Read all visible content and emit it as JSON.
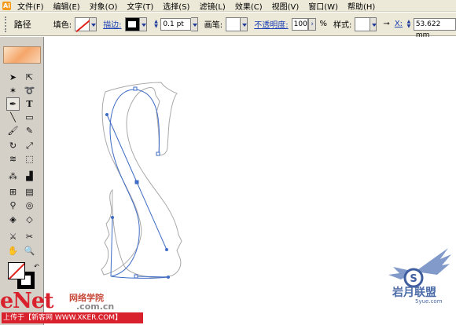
{
  "app": {
    "icon_letter": "Ai"
  },
  "menu": {
    "items": [
      "文件(F)",
      "编辑(E)",
      "对象(O)",
      "文字(T)",
      "选择(S)",
      "滤镜(L)",
      "效果(C)",
      "视图(V)",
      "窗口(W)",
      "帮助(H)"
    ]
  },
  "control_bar": {
    "object_type": "路径",
    "fill_label": "填色:",
    "stroke_label": "描边:",
    "stroke_weight": "0.1 pt",
    "brush_label": "画笔:",
    "opacity_label": "不透明度:",
    "opacity_value": "100",
    "opacity_unit": "%",
    "style_label": "样式:",
    "x_label": "X:",
    "x_value": "53.622 mm"
  },
  "toolbox": {
    "tools": [
      "selection-tool",
      "direct-selection-tool",
      "magic-wand-tool",
      "lasso-tool",
      "pen-tool",
      "type-tool",
      "line-tool",
      "rectangle-tool",
      "paintbrush-tool",
      "pencil-tool",
      "rotate-tool",
      "scale-tool",
      "warp-tool",
      "free-transform-tool",
      "symbol-sprayer-tool",
      "column-graph-tool",
      "mesh-tool",
      "gradient-tool",
      "eyedropper-tool",
      "blend-tool",
      "live-paint-tool",
      "live-paint-selection-tool",
      "slice-tool",
      "scissors-tool",
      "hand-tool",
      "zoom-tool"
    ],
    "fill": "none",
    "stroke": "#000000"
  },
  "watermarks": {
    "enet": "eNet",
    "enet_cn": "网络学院",
    "enet_com": ".com.cn",
    "upload": "上传于【新客网 WWW.XKER.COM】",
    "logo_text": "岩月联盟",
    "logo_sub": "5yue.com"
  },
  "colors": {
    "path_blue": "#3f6cc4",
    "outline_gray": "#a8a8a8",
    "brand_red": "#d8212c"
  }
}
